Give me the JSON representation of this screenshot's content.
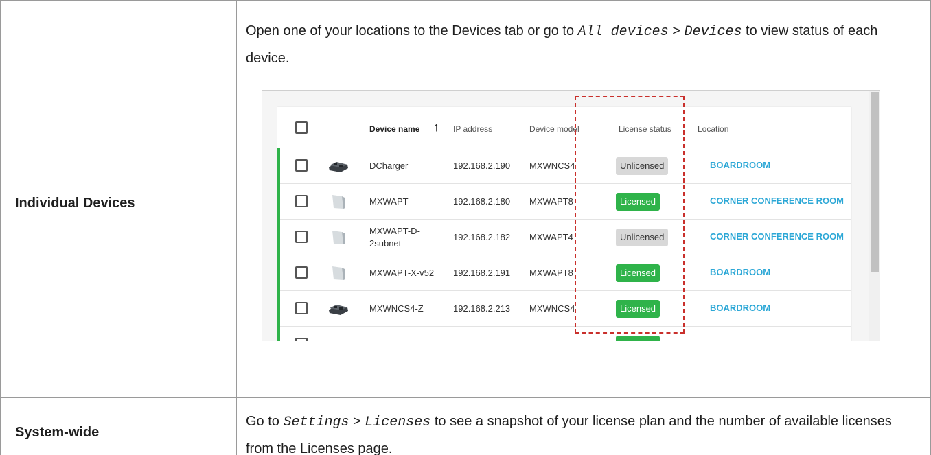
{
  "rows": [
    {
      "label": "Individual Devices",
      "desc_parts": [
        "Open one of your locations to the Devices tab or go to ",
        "All devices",
        " > ",
        "Devices",
        " to view status of each device."
      ]
    },
    {
      "label": "System-wide",
      "desc_parts": [
        "Go to ",
        "Settings",
        " > ",
        "Licenses",
        " to see a snapshot of your license plan and the number of available licenses from the Licenses page."
      ]
    }
  ],
  "screenshot": {
    "headers": {
      "device_name": "Device name",
      "sort_icon": "↑",
      "ip": "IP address",
      "model": "Device model",
      "license": "License status",
      "location": "Location"
    },
    "devices": [
      {
        "name": "DCharger",
        "ip": "192.168.2.190",
        "model": "MXWNCS4",
        "license": "Unlicensed",
        "location": "BOARDROOM",
        "icon": "charger-icon"
      },
      {
        "name": "MXWAPT",
        "ip": "192.168.2.180",
        "model": "MXWAPT8",
        "license": "Licensed",
        "location": "CORNER CONFERENCE ROOM",
        "icon": "access-point-icon"
      },
      {
        "name": "MXWAPT-D-2subnet",
        "ip": "192.168.2.182",
        "model": "MXWAPT4",
        "license": "Unlicensed",
        "location": "CORNER CONFERENCE ROOM",
        "icon": "access-point-icon"
      },
      {
        "name": "MXWAPT-X-v52",
        "ip": "192.168.2.191",
        "model": "MXWAPT8",
        "license": "Licensed",
        "location": "BOARDROOM",
        "icon": "access-point-icon"
      },
      {
        "name": "MXWNCS4-Z",
        "ip": "192.168.2.213",
        "model": "MXWNCS4",
        "license": "Licensed",
        "location": "BOARDROOM",
        "icon": "charger-icon"
      }
    ],
    "colors": {
      "licensed": "#2fb34a",
      "unlicensed": "#d8d8d8",
      "location_link": "#2ba7d6",
      "highlight_box": "#c9302c"
    }
  }
}
